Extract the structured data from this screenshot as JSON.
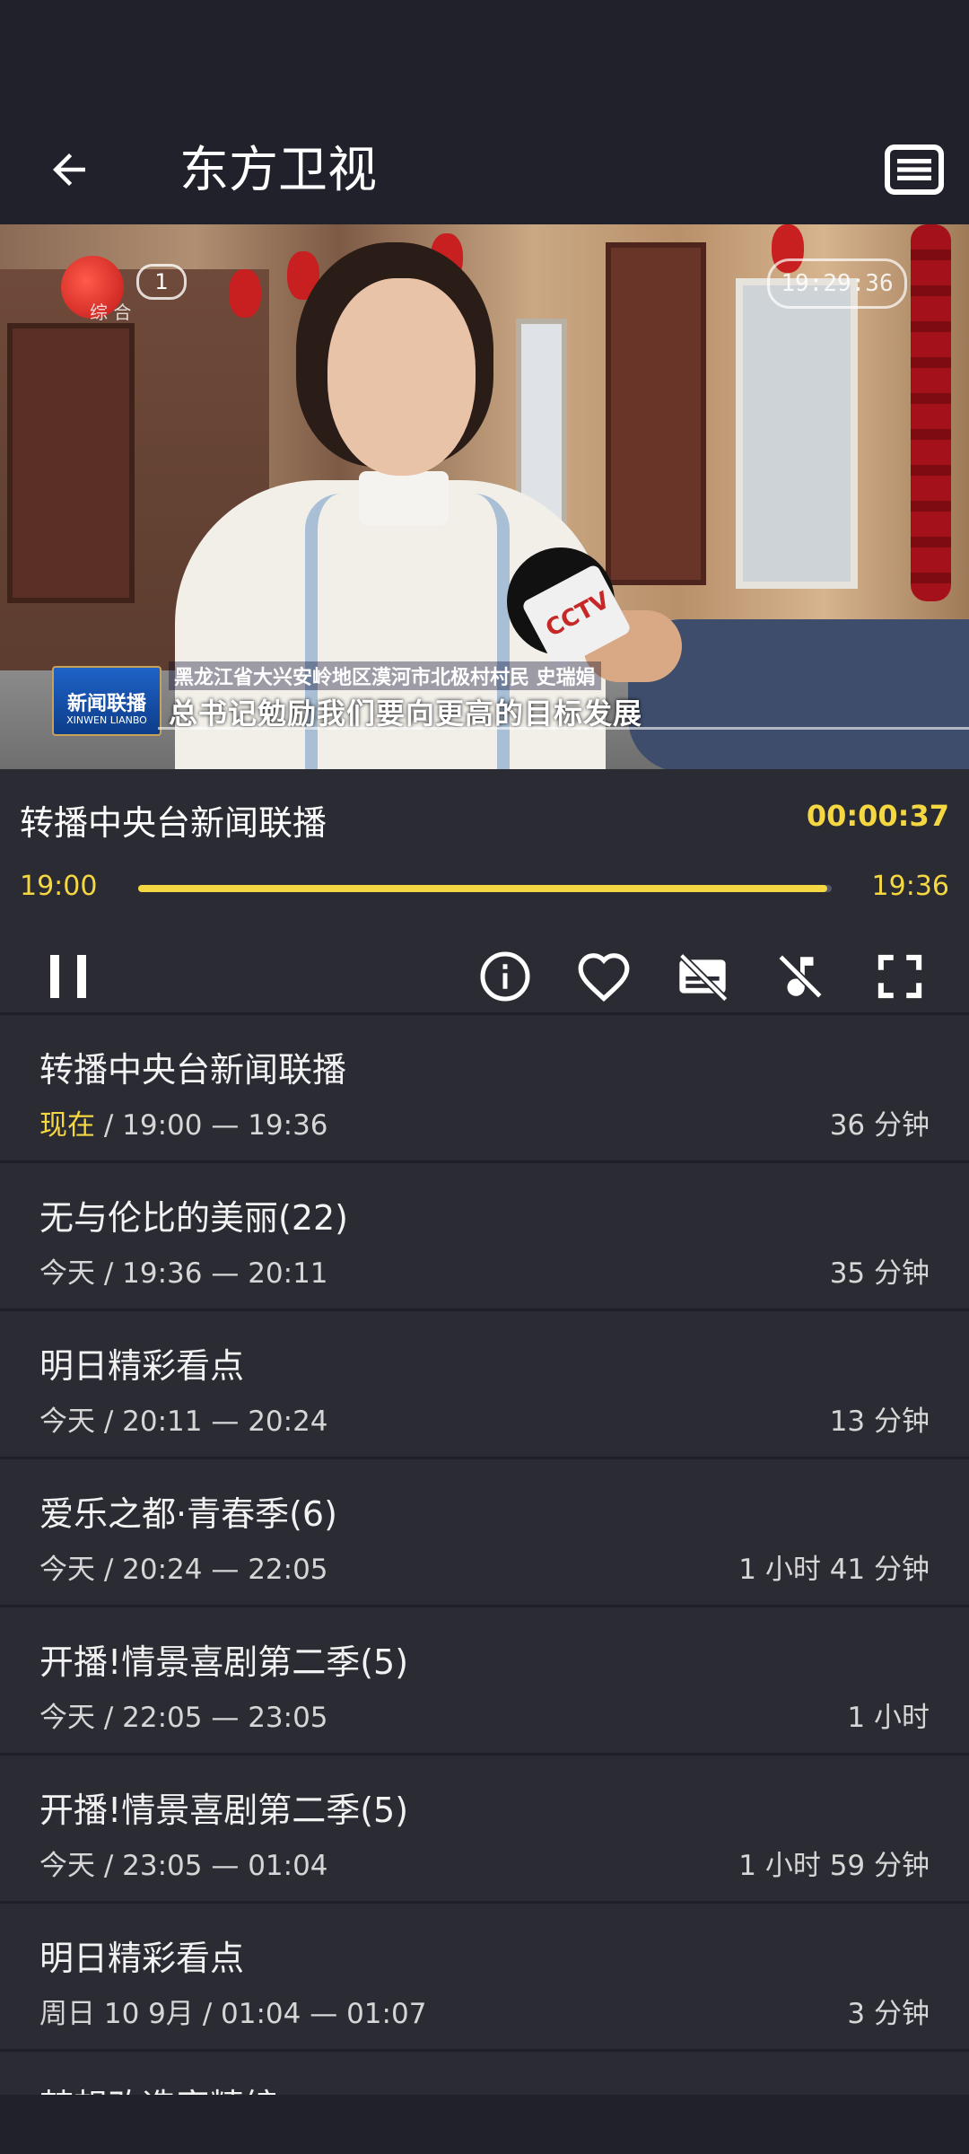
{
  "app_bar": {
    "title": "东方卫视"
  },
  "video": {
    "channel_number": "1",
    "channel_text": "综 合",
    "clock": "19:29:36",
    "caption_logo": "新闻联播",
    "caption_logo_sub": "XINWEN LIANBO",
    "caption_line1": "黑龙江省大兴安岭地区漠河市北极村村民 史瑞娟",
    "caption_line2": "总书记勉励我们要向更高的目标发展",
    "mic_logo": "CCTV"
  },
  "now_playing": {
    "title": "转播中央台新闻联播",
    "elapsed": "00:00:37",
    "start": "19:00",
    "end": "19:36",
    "progress_fraction": 0.994
  },
  "controls": {
    "icons": [
      "pause-icon",
      "info-icon",
      "heart-icon",
      "subtitles-off-icon",
      "music-off-icon",
      "fullscreen-icon"
    ]
  },
  "schedule": [
    {
      "title": "转播中央台新闻联播",
      "day": "现在",
      "range": " / 19:00 — 19:36",
      "duration": "36 分钟",
      "current": true
    },
    {
      "title": "无与伦比的美丽(22)",
      "day": "今天",
      "range": " / 19:36 — 20:11",
      "duration": "35 分钟",
      "current": false
    },
    {
      "title": "明日精彩看点",
      "day": "今天",
      "range": " / 20:11 — 20:24",
      "duration": "13 分钟",
      "current": false
    },
    {
      "title": "爱乐之都·青春季(6)",
      "day": "今天",
      "range": " / 20:24 — 22:05",
      "duration": "1 小时 41 分钟",
      "current": false
    },
    {
      "title": "开播!情景喜剧第二季(5)",
      "day": "今天",
      "range": " / 22:05 — 23:05",
      "duration": "1 小时",
      "current": false
    },
    {
      "title": "开播!情景喜剧第二季(5)",
      "day": "今天",
      "range": " / 23:05 — 01:04",
      "duration": "1 小时 59 分钟",
      "current": false
    },
    {
      "title": "明日精彩看点",
      "day": "周日 10 9月",
      "range": " / 01:04 — 01:07",
      "duration": "3 分钟",
      "current": false
    },
    {
      "title": "梦想改造家精编",
      "day": "",
      "range": "",
      "duration": "",
      "current": false
    }
  ],
  "colors": {
    "accent": "#f5d742",
    "background": "#2b2c33",
    "bar": "#20212a"
  }
}
